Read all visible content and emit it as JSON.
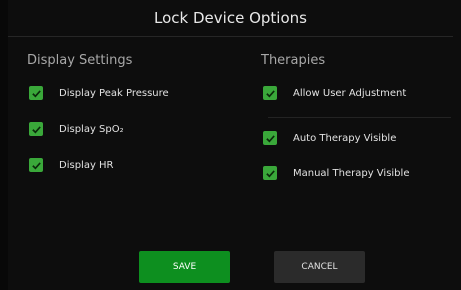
{
  "dialog": {
    "title": "Lock Device Options"
  },
  "display_settings": {
    "heading": "Display Settings",
    "items": [
      {
        "label": "Display Peak Pressure",
        "checked": true
      },
      {
        "label": "Display SpO₂",
        "checked": true
      },
      {
        "label": "Display HR",
        "checked": true
      }
    ]
  },
  "therapies": {
    "heading": "Therapies",
    "items": [
      {
        "label": "Allow User Adjustment",
        "checked": true
      },
      {
        "label": "Auto Therapy Visible",
        "checked": true
      },
      {
        "label": "Manual Therapy Visible",
        "checked": true
      }
    ]
  },
  "buttons": {
    "save": "SAVE",
    "cancel": "CANCEL"
  },
  "colors": {
    "background": "#0d0d0d",
    "checkbox": "#3aa83a",
    "save_button": "#0d8f1f",
    "cancel_button": "#2b2b2b"
  },
  "icons": {
    "checkbox": "checkmark-icon"
  }
}
